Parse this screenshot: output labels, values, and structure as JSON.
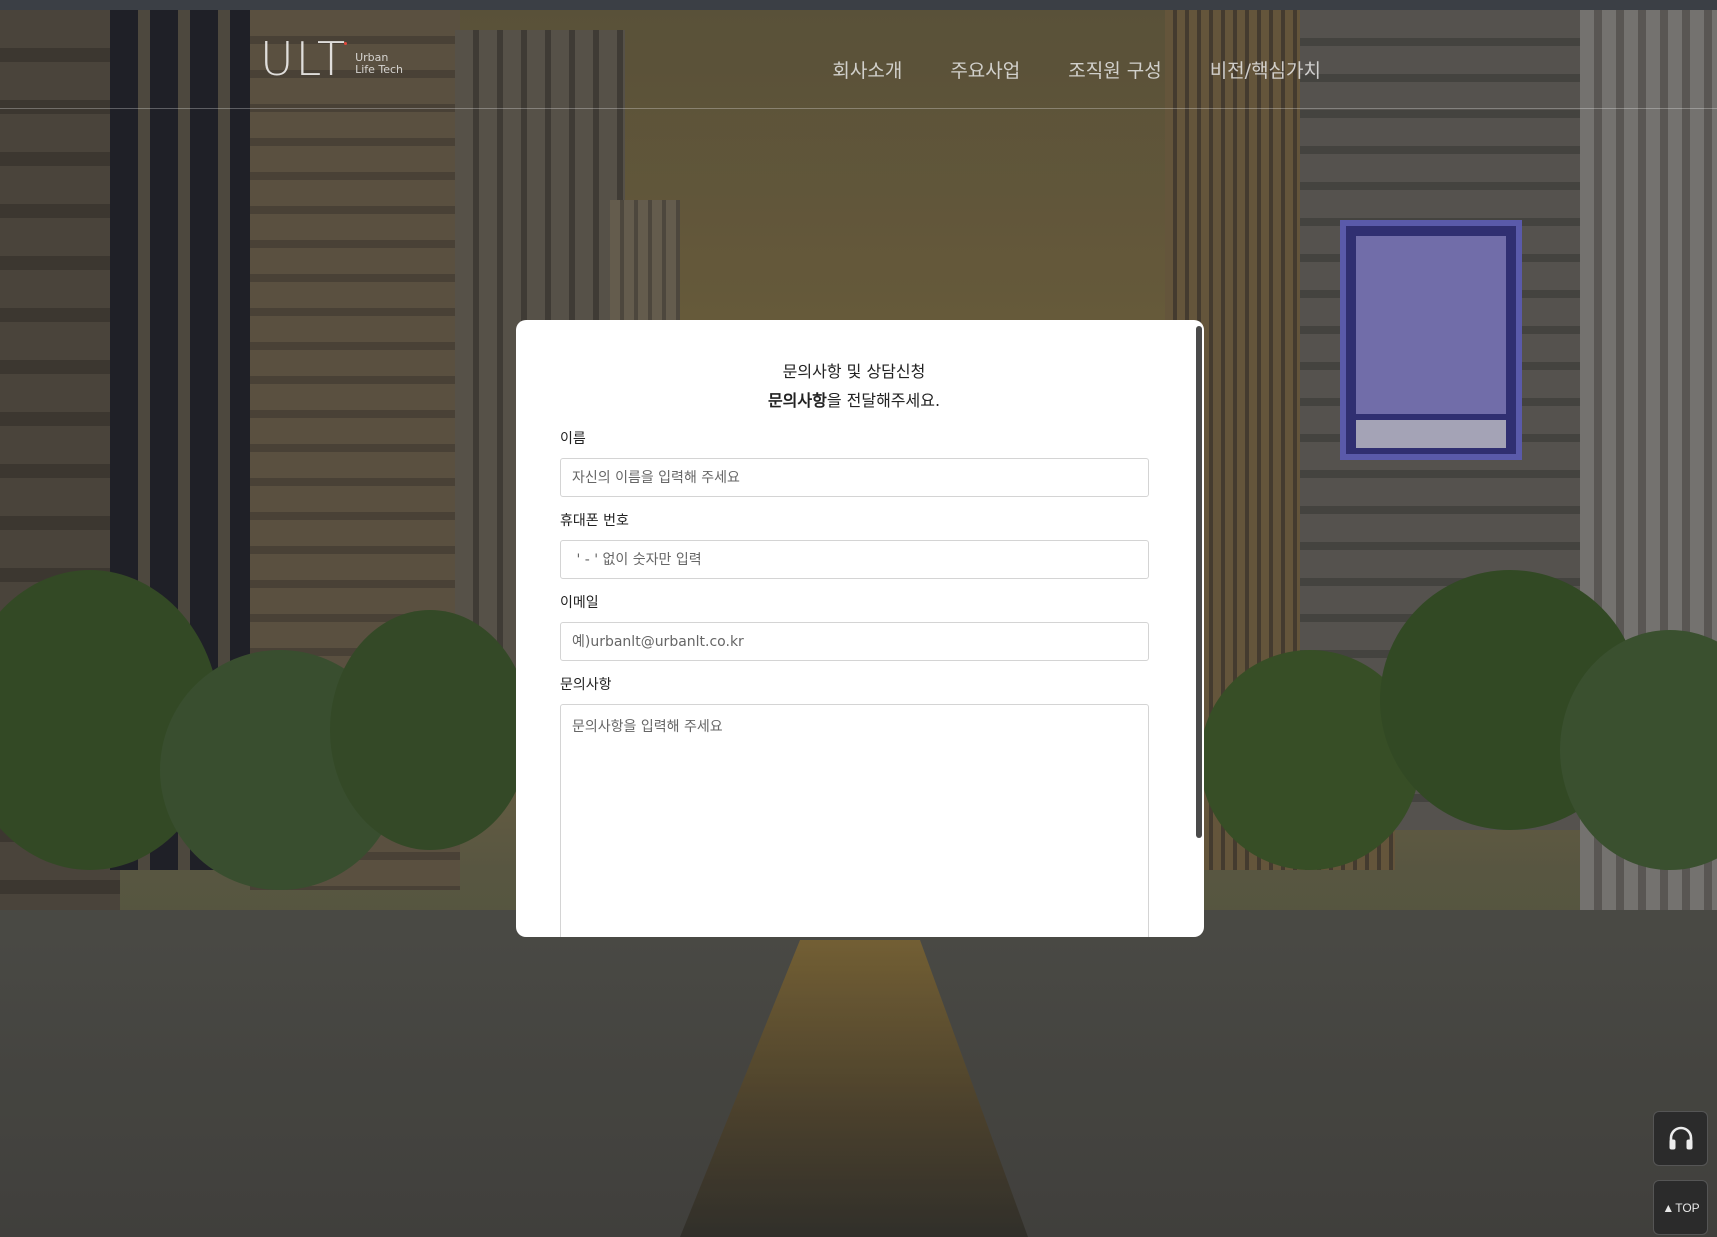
{
  "header": {
    "logo_mark": "ULT",
    "logo_sub_line1": "Urban",
    "logo_sub_line2": "Life Tech",
    "nav": [
      {
        "label": "회사소개"
      },
      {
        "label": "주요사업"
      },
      {
        "label": "조직원 구성"
      },
      {
        "label": "비전/핵심가치"
      }
    ]
  },
  "modal": {
    "title_line1": "문의사항 및 상담신청",
    "title_line2_bold": "문의사항",
    "title_line2_rest": "을 전달해주세요.",
    "fields": {
      "name": {
        "label": "이름",
        "placeholder": "자신의 이름을 입력해 주세요"
      },
      "phone": {
        "label": "휴대폰 번호",
        "placeholder": " ' - ' 없이 숫자만 입력"
      },
      "email": {
        "label": "이메일",
        "placeholder": "예)urbanlt@urbanlt.co.kr"
      },
      "inquiry": {
        "label": "문의사항",
        "placeholder": "문의사항을 입력해 주세요"
      }
    }
  },
  "floating": {
    "support_icon": "headset-icon",
    "top_arrow": "▲",
    "top_label": "TOP"
  },
  "colors": {
    "modal_bg": "#ffffff",
    "header_divider": "rgba(255,255,255,0.28)",
    "logo_accent": "#e2473b",
    "float_btn_bg": "#2b2b2b"
  }
}
